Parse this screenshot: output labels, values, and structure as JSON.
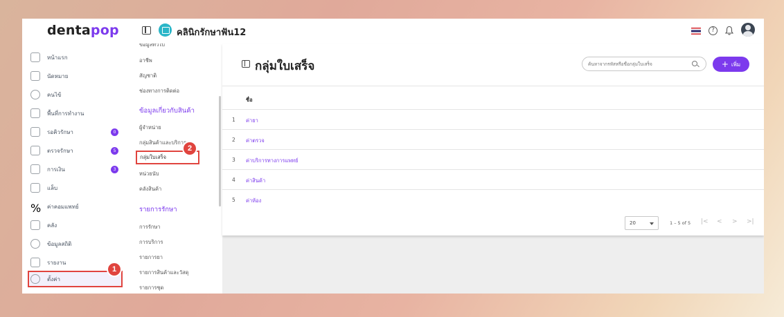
{
  "topbar": {
    "logo_prefix": "denta",
    "logo_suffix": "pop",
    "clinic_name": "คลินิกรักษาฟัน12"
  },
  "nav": {
    "items": [
      {
        "label": "หน้าแรก",
        "icon": "home-icon"
      },
      {
        "label": "นัดหมาย",
        "icon": "calendar-icon"
      },
      {
        "label": "คนไข้",
        "icon": "user-icon"
      },
      {
        "label": "พื้นที่การทำงาน",
        "icon": "workspace-icon"
      },
      {
        "label": "รอคิวรักษา",
        "icon": "chair-icon",
        "badge": "0"
      },
      {
        "label": "ตรวจรักษา",
        "icon": "tools-icon",
        "badge": "5"
      },
      {
        "label": "การเงิน",
        "icon": "money-icon",
        "badge": "3"
      },
      {
        "label": "แล็บ",
        "icon": "tooth-icon"
      },
      {
        "label": "ค่าคอมแพทย์",
        "icon": "percent-icon"
      },
      {
        "label": "คลัง",
        "icon": "box-icon"
      },
      {
        "label": "ข้อมูลสถิติ",
        "icon": "stats-icon"
      },
      {
        "label": "รายงาน",
        "icon": "report-icon"
      },
      {
        "label": "ตั้งค่า",
        "icon": "gear-icon"
      }
    ]
  },
  "submenu": {
    "top_cut": "ข้อมูลทั่วไป",
    "items_a": [
      "อาชีพ",
      "สัญชาติ",
      "ช่องทางการติดต่อ"
    ],
    "section_products": "ข้อมูลเกี่ยวกับสินค้า",
    "items_b": [
      "ผู้จำหน่าย",
      "กลุ่มสินค้าและบริการ",
      "กลุ่มใบเสร็จ",
      "หน่วยนับ",
      "คลังสินค้า"
    ],
    "section_treatment": "รายการรักษา",
    "items_c": [
      "การรักษา",
      "การบริการ",
      "รายการยา",
      "รายการสินค้าและวัสดุ",
      "รายการชุด"
    ]
  },
  "main": {
    "title": "กลุ่มใบเสร็จ",
    "search_placeholder": "ค้นหาจากรหัสหรือชื่อกลุ่มใบเสร็จ",
    "add_label": "เพิ่ม",
    "column_name": "ชื่อ",
    "rows": [
      {
        "num": "1",
        "name": "ค่ายา"
      },
      {
        "num": "2",
        "name": "ค่าตรวจ"
      },
      {
        "num": "3",
        "name": "ค่าบริการทางการแพทย์"
      },
      {
        "num": "4",
        "name": "ค่าสินค้า"
      },
      {
        "num": "5",
        "name": "ค่าห้อง"
      }
    ],
    "page_size": "20",
    "range": "1 – 5 of 5"
  },
  "markers": {
    "one": "1",
    "two": "2"
  },
  "colors": {
    "accent": "#7c3aed",
    "marker": "#e0443e"
  }
}
